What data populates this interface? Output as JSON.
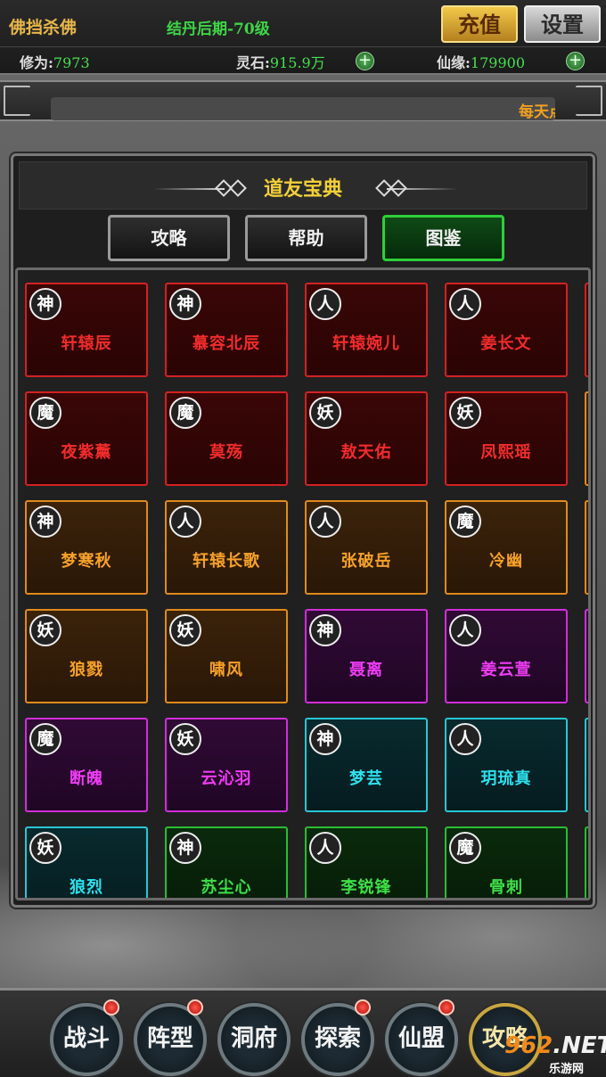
{
  "player": {
    "name": "佛挡杀佛",
    "rank": "结丹后期-70级",
    "recharge_label": "充值",
    "settings_label": "设置"
  },
  "stats": [
    {
      "label": "修为:",
      "value": "7973"
    },
    {
      "label": "灵石:",
      "value": "915.9万"
    },
    {
      "label": "仙缘:",
      "value": "179900"
    }
  ],
  "ticker": "每天点",
  "panel": {
    "title": "道友宝典",
    "tabs": [
      "攻略",
      "帮助",
      "图鉴"
    ],
    "active_tab": "图鉴"
  },
  "cards": [
    {
      "race": "神",
      "name": "轩辕辰",
      "quality": "red"
    },
    {
      "race": "神",
      "name": "慕容北辰",
      "quality": "red"
    },
    {
      "race": "人",
      "name": "轩辕婉儿",
      "quality": "red"
    },
    {
      "race": "人",
      "name": "姜长文",
      "quality": "red"
    },
    {
      "race": "魔",
      "name": "夜紫薰",
      "quality": "red"
    },
    {
      "race": "魔",
      "name": "莫殇",
      "quality": "red"
    },
    {
      "race": "妖",
      "name": "敖天佑",
      "quality": "red"
    },
    {
      "race": "妖",
      "name": "凤熙瑶",
      "quality": "red"
    },
    {
      "race": "神",
      "name": "梦寒秋",
      "quality": "orange"
    },
    {
      "race": "人",
      "name": "轩辕长歌",
      "quality": "orange"
    },
    {
      "race": "人",
      "name": "张破岳",
      "quality": "orange"
    },
    {
      "race": "魔",
      "name": "冷幽",
      "quality": "orange"
    },
    {
      "race": "妖",
      "name": "狼戮",
      "quality": "orange"
    },
    {
      "race": "妖",
      "name": "啸风",
      "quality": "orange"
    },
    {
      "race": "神",
      "name": "聂离",
      "quality": "purple"
    },
    {
      "race": "人",
      "name": "姜云萱",
      "quality": "purple"
    },
    {
      "race": "魔",
      "name": "断魄",
      "quality": "purple"
    },
    {
      "race": "妖",
      "name": "云沁羽",
      "quality": "purple"
    },
    {
      "race": "神",
      "name": "梦芸",
      "quality": "cyan"
    },
    {
      "race": "人",
      "name": "玥琉真",
      "quality": "cyan"
    },
    {
      "race": "妖",
      "name": "狼烈",
      "quality": "cyan"
    },
    {
      "race": "神",
      "name": "苏尘心",
      "quality": "green"
    },
    {
      "race": "人",
      "name": "李锐锋",
      "quality": "green"
    },
    {
      "race": "魔",
      "name": "骨刺",
      "quality": "green"
    }
  ],
  "edge_quality": [
    "red",
    "orange",
    "orange",
    "purple",
    "cyan",
    "green"
  ],
  "quality_colors": {
    "red": "#d12222",
    "orange": "#e08a1c",
    "purple": "#d12ed8",
    "cyan": "#28c6d4",
    "green": "#2bbd33"
  },
  "nav": [
    {
      "label": "战斗",
      "badge": true
    },
    {
      "label": "阵型",
      "badge": true
    },
    {
      "label": "洞府",
      "badge": false
    },
    {
      "label": "探索",
      "badge": true
    },
    {
      "label": "仙盟",
      "badge": true
    },
    {
      "label": "攻略",
      "badge": false,
      "active": true
    }
  ],
  "watermark": {
    "num": "962",
    "suffix": ".NET",
    "sub": "乐游网"
  }
}
